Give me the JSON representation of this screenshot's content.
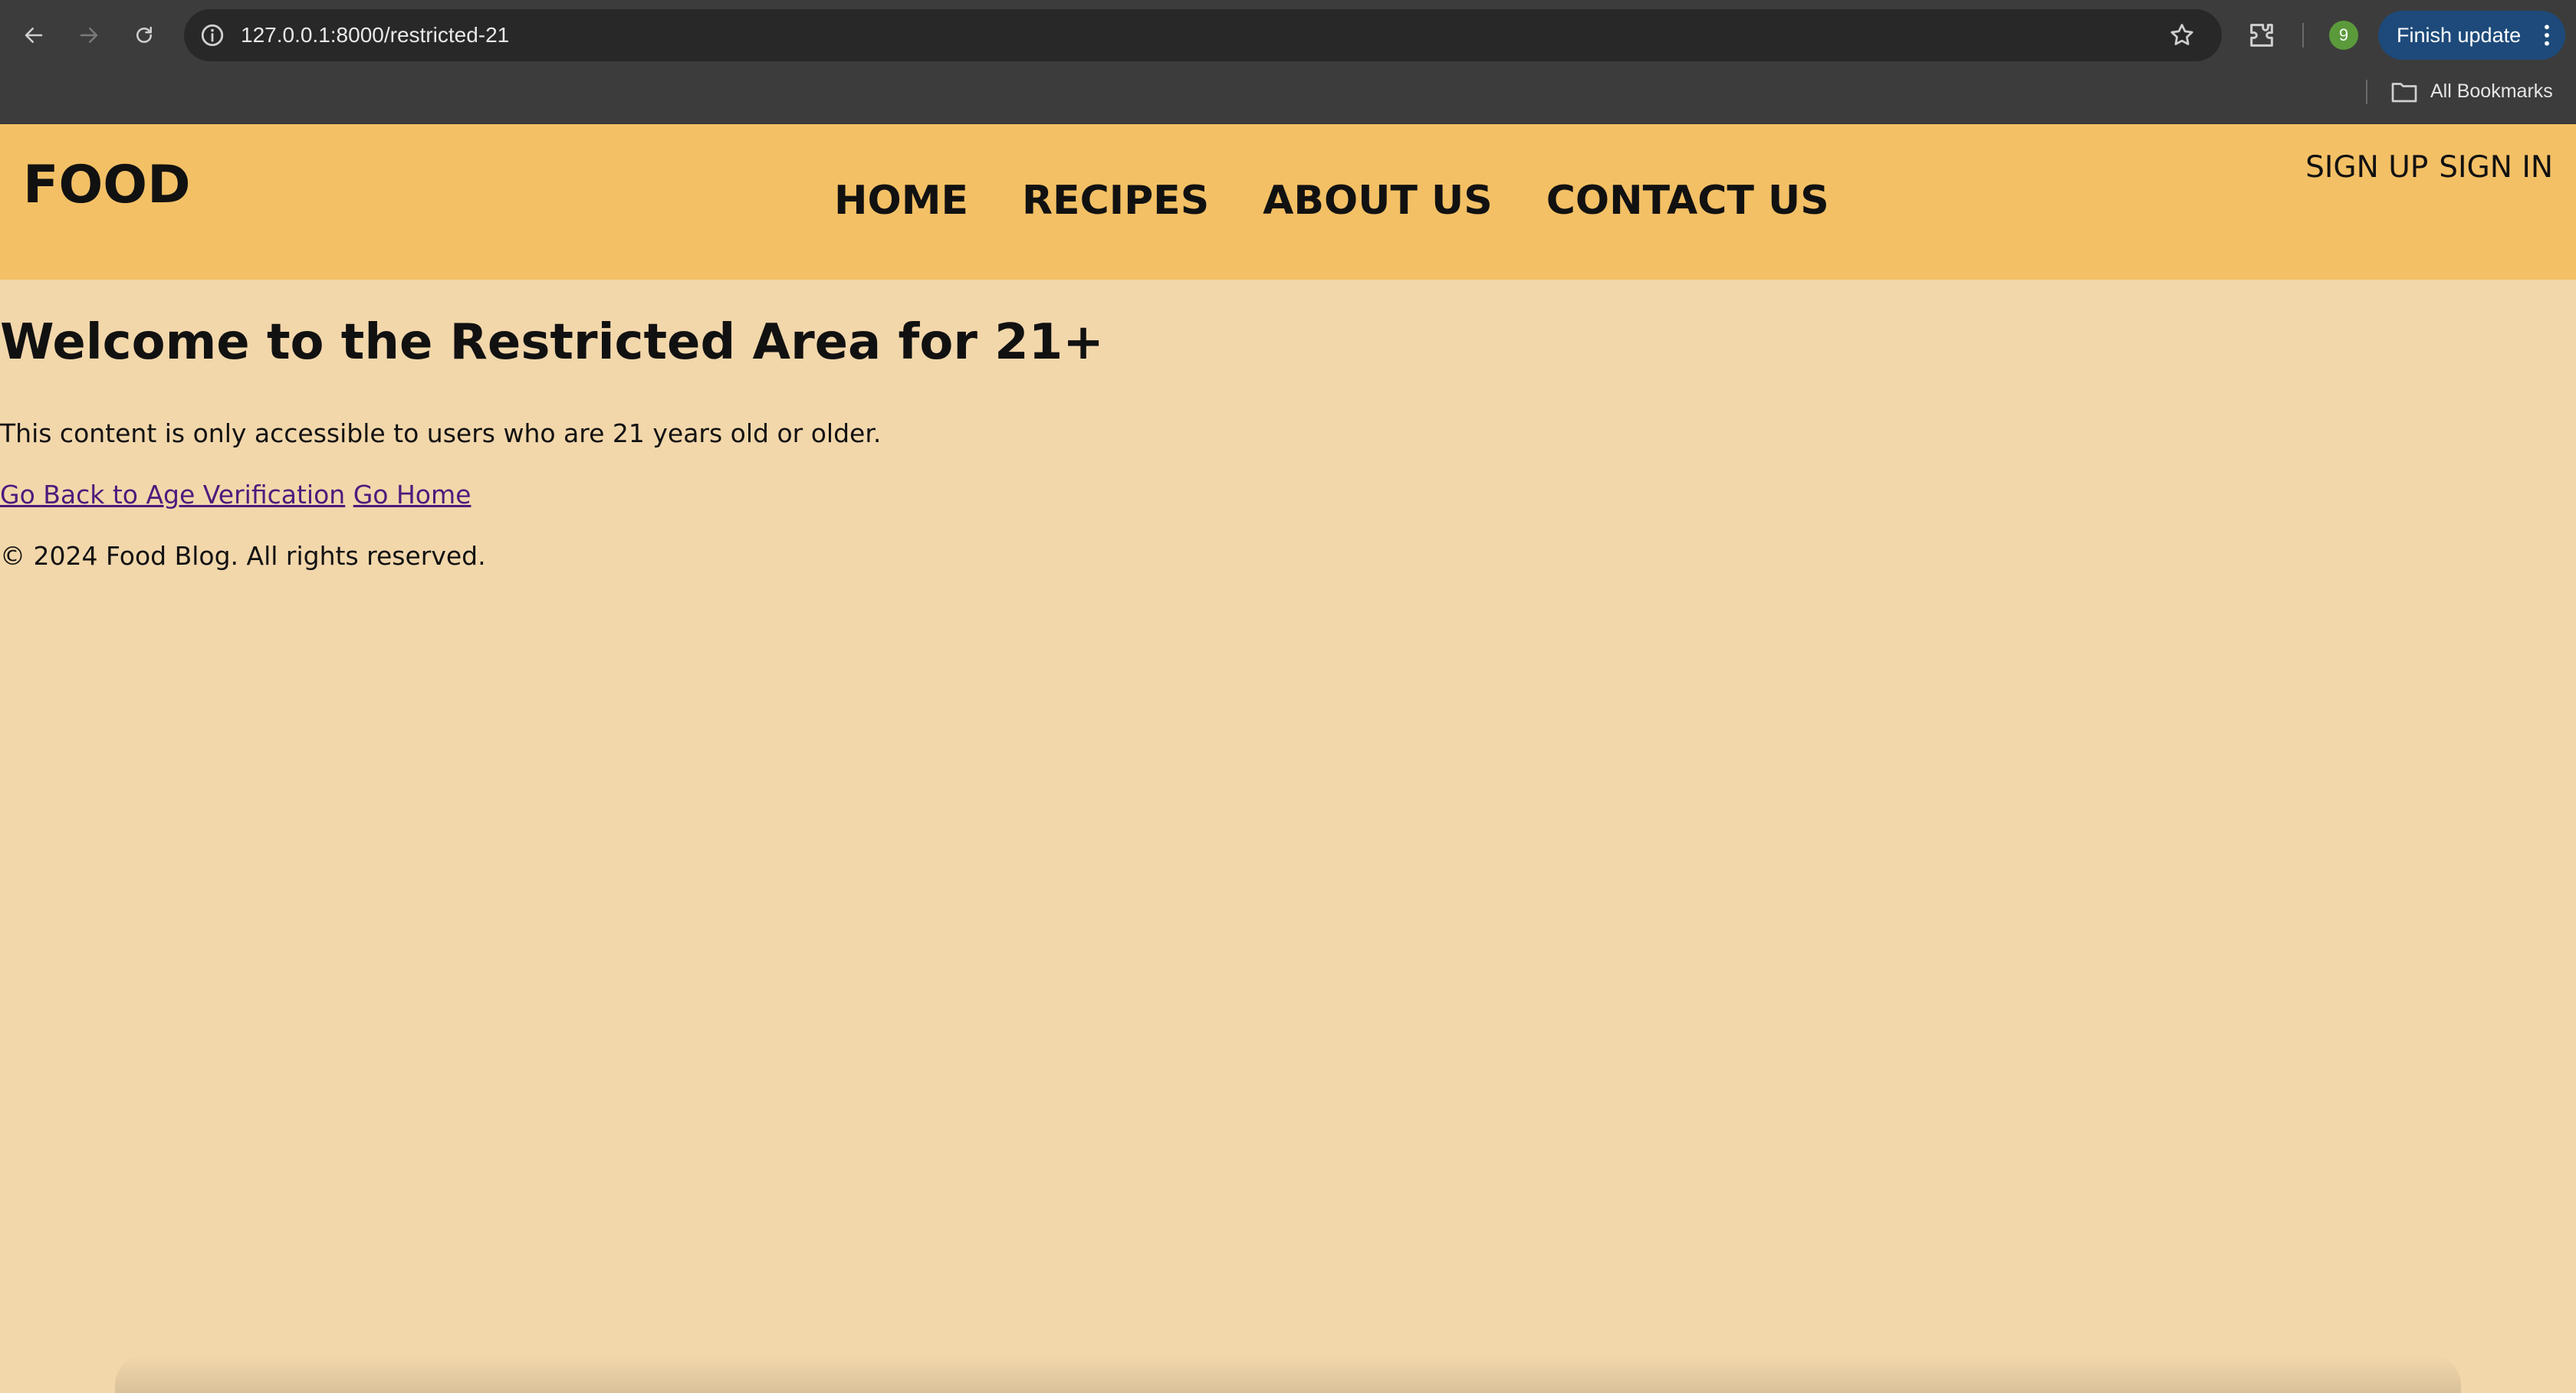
{
  "browser": {
    "url": "127.0.0.1:8000/restricted-21",
    "profile_initial": "9",
    "finish_update_label": "Finish update",
    "bookmarks_label": "All Bookmarks",
    "icons": [
      "back-icon",
      "forward-icon",
      "reload-icon",
      "site-info-icon",
      "star-icon",
      "extensions-icon",
      "kebab-icon",
      "folder-icon"
    ]
  },
  "header": {
    "logo": "FOOD",
    "nav": [
      {
        "label": "HOME"
      },
      {
        "label": "RECIPES"
      },
      {
        "label": "ABOUT US"
      },
      {
        "label": "CONTACT US"
      }
    ],
    "sign_up": "SIGN UP",
    "sign_in": "SIGN IN"
  },
  "main": {
    "title": "Welcome to the Restricted Area for 21+",
    "description": "This content is only accessible to users who are 21 years old or older.",
    "back_link": "Go Back to Age Verification",
    "home_link": "Go Home",
    "footer": "© 2024 Food Blog. All rights reserved."
  },
  "colors": {
    "chrome_bg": "#3c3c3c",
    "omnibox_bg": "#282828",
    "header_bg": "#f3c065",
    "page_bg": "#f2d7ab",
    "link": "#4b1b7d",
    "update_button": "#1d4a7a",
    "avatar": "#5b9a3b"
  }
}
